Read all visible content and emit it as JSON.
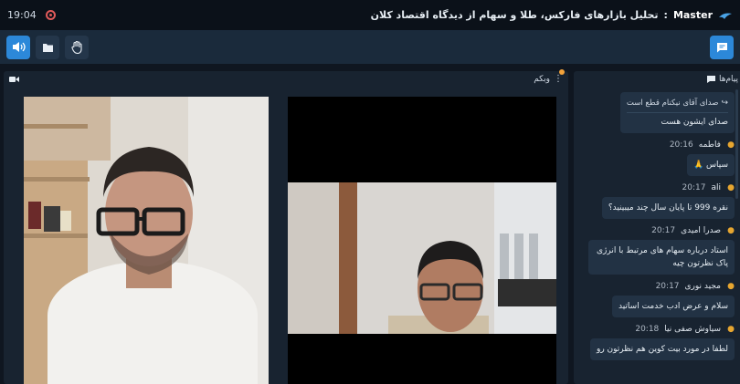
{
  "topbar": {
    "time": "19:04",
    "master_label": "Master",
    "separator": ":",
    "session_title": "تحلیل بازارهای فارکس، طلا و سهام از دیدگاه اقتصاد کلان"
  },
  "toolbar": {
    "icons": [
      "speaker-icon",
      "folder-icon",
      "raise-hand-icon"
    ],
    "chat_icon": "chat-icon"
  },
  "webcam": {
    "title": "وبکم",
    "camera_icon": "video-camera-icon",
    "menu_icon": "vertical-dots-icon"
  },
  "chat": {
    "title": "پیام‌ها",
    "messages": [
      {
        "reply_quote": "صدای آقای نیکنام قطع است",
        "text": "صدای ایشون هست"
      },
      {
        "name": "فاطمه",
        "time": "20:16",
        "text": "سپاس 🙏"
      },
      {
        "name": "ali",
        "time": "20:17",
        "text": "نقره 999 تا پایان سال چند میبینید؟"
      },
      {
        "name": "صدرا امیدی",
        "time": "20:17",
        "text": "استاد درباره سهام های مرتبط با انرژی پاک نظرتون چیه"
      },
      {
        "name": "مجید نوری",
        "time": "20:17",
        "text": "سلام و عرض ادب خدمت اساتید"
      },
      {
        "name": "سیاوش صفی نیا",
        "time": "20:18",
        "text": "لطفا در مورد بیت کوین هم نظرتون رو"
      }
    ]
  },
  "colors": {
    "accent": "#2c88d9",
    "recording": "#e05a5a",
    "notification": "#f2a23a",
    "user_icon": "#e7a630"
  }
}
